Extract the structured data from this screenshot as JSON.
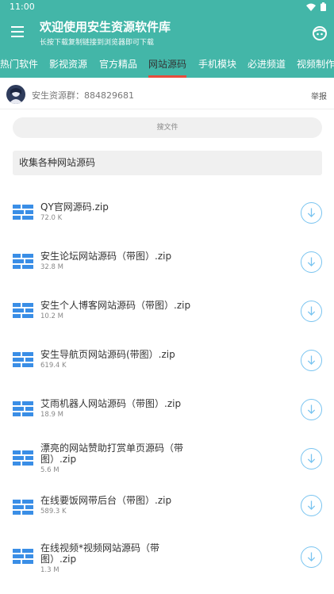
{
  "status": {
    "time": "11:00"
  },
  "header": {
    "title": "欢迎使用安生资源软件库",
    "subtitle": "长按下载复制链接到浏览器即可下载",
    "menu_icon": "menu-icon",
    "profile_icon": "face-icon"
  },
  "tabs": [
    {
      "label": "热门软件",
      "active": false
    },
    {
      "label": "影视资源",
      "active": false
    },
    {
      "label": "官方精品",
      "active": false
    },
    {
      "label": "网站源码",
      "active": true
    },
    {
      "label": "手机模块",
      "active": false
    },
    {
      "label": "必进频道",
      "active": false
    },
    {
      "label": "视频制作",
      "active": false
    }
  ],
  "group": {
    "text": "安生资源群：884829681",
    "report": "举报"
  },
  "search": {
    "placeholder": "搜文件"
  },
  "notice": "收集各种网站源码",
  "files": [
    {
      "name": "QY官网源码.zip",
      "size": "72.0 K"
    },
    {
      "name": "安生论坛网站源码（带图）.zip",
      "size": "32.8 M"
    },
    {
      "name": "安生个人博客网站源码（带图）.zip",
      "size": "10.2 M"
    },
    {
      "name": "安生导航页网站源码(带图）.zip",
      "size": "619.4 K"
    },
    {
      "name": "艾雨机器人网站源码（带图）.zip",
      "size": "18.9 M"
    },
    {
      "name": "漂亮的网站赞助打赏单页源码（带图）.zip",
      "size": "5.6 M"
    },
    {
      "name": "在线要饭网带后台（带图）.zip",
      "size": "589.3 K"
    },
    {
      "name": "在线视频*视频网站源码（带图）.zip",
      "size": "1.3 M"
    }
  ],
  "colors": {
    "primary": "#43b6a8",
    "tab_indicator": "#e74c3c",
    "file_icon": "#3a8ee6",
    "download_ring": "#79c4f0"
  }
}
